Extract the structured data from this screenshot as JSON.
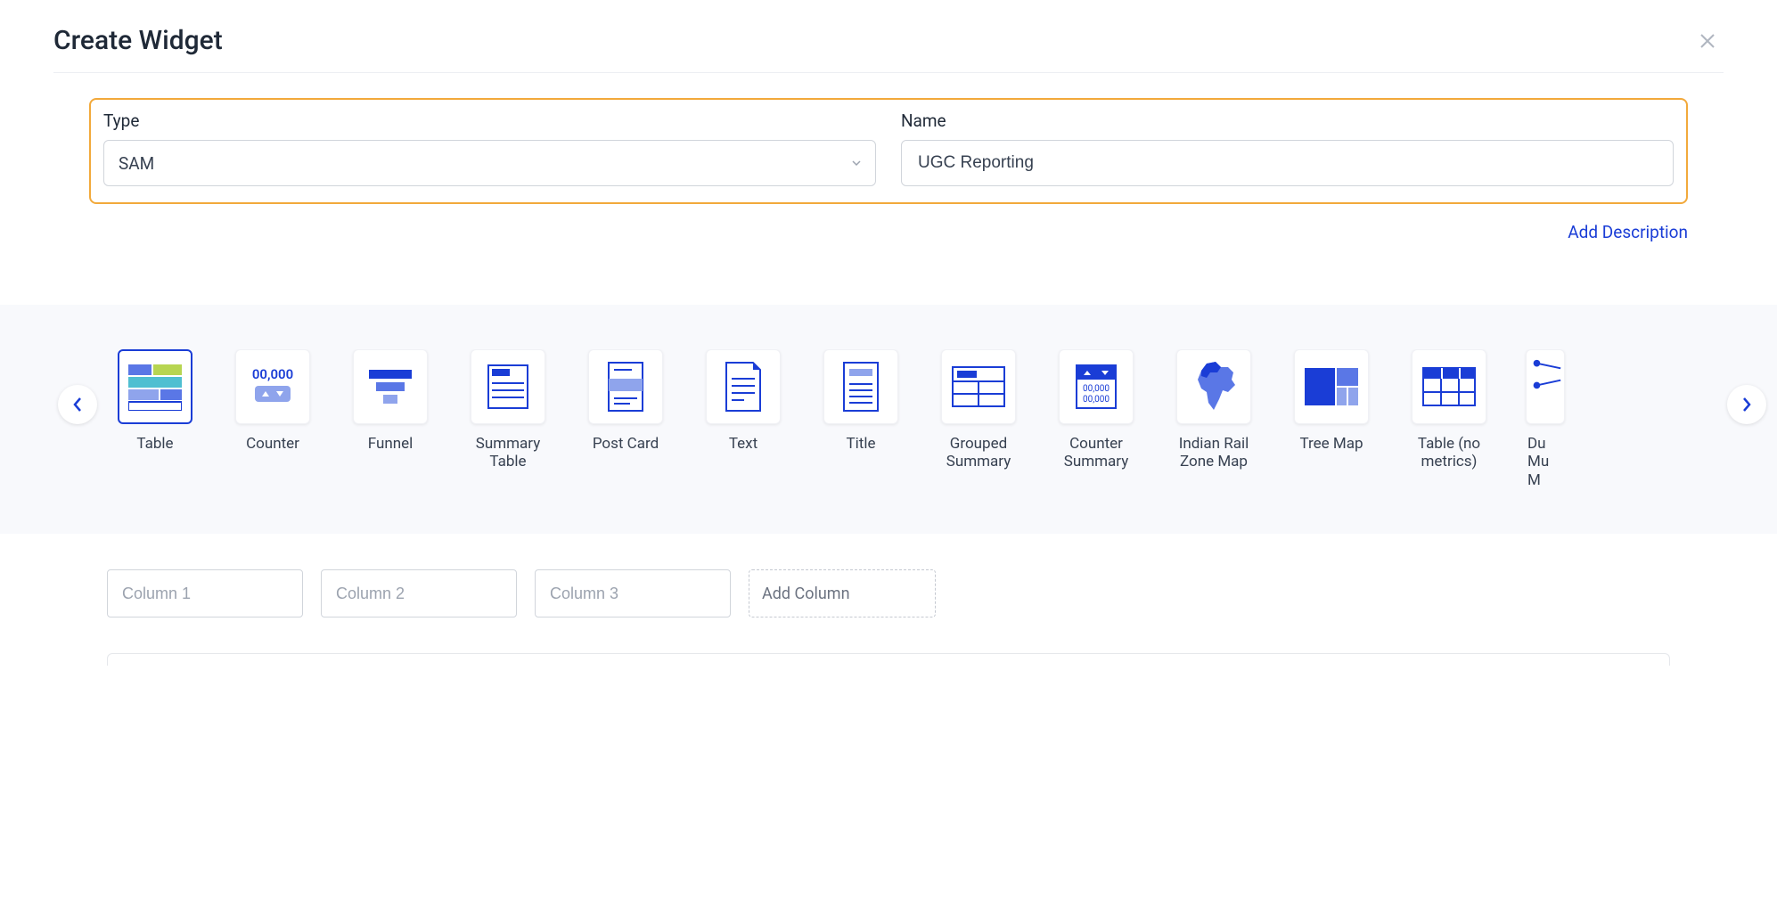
{
  "header": {
    "title": "Create Widget"
  },
  "form": {
    "type_label": "Type",
    "type_value": "SAM",
    "name_label": "Name",
    "name_value": "UGC Reporting",
    "add_description": "Add Description"
  },
  "widget_types": [
    {
      "id": "table",
      "label": "Table",
      "icon": "table-icon",
      "selected": true
    },
    {
      "id": "counter",
      "label": "Counter",
      "icon": "counter-icon",
      "selected": false
    },
    {
      "id": "funnel",
      "label": "Funnel",
      "icon": "funnel-icon",
      "selected": false
    },
    {
      "id": "summary-table",
      "label": "Summary Table",
      "icon": "summary-table-icon",
      "selected": false
    },
    {
      "id": "post-card",
      "label": "Post Card",
      "icon": "post-card-icon",
      "selected": false
    },
    {
      "id": "text",
      "label": "Text",
      "icon": "text-icon",
      "selected": false
    },
    {
      "id": "title",
      "label": "Title",
      "icon": "title-icon",
      "selected": false
    },
    {
      "id": "grouped-summary",
      "label": "Grouped Summary",
      "icon": "grouped-summary-icon",
      "selected": false
    },
    {
      "id": "counter-summary",
      "label": "Counter Summary",
      "icon": "counter-summary-icon",
      "selected": false
    },
    {
      "id": "indian-rail",
      "label": "Indian Rail Zone Map",
      "icon": "india-map-icon",
      "selected": false
    },
    {
      "id": "tree-map",
      "label": "Tree Map",
      "icon": "tree-map-icon",
      "selected": false
    },
    {
      "id": "table-no-metrics",
      "label": "Table (no metrics)",
      "icon": "table-outline-icon",
      "selected": false
    },
    {
      "id": "dual-multi",
      "label": "Du\nMu\nM",
      "icon": "dual-icon",
      "selected": false,
      "clipped": true
    }
  ],
  "columns": {
    "placeholder_1": "Column 1",
    "placeholder_2": "Column 2",
    "placeholder_3": "Column 3",
    "add_label": "Add Column"
  },
  "colors": {
    "brand": "#1a3dd6",
    "brand_mid": "#5a77e6",
    "brand_light": "#8fa4ec",
    "accent_green": "#b7d551",
    "accent_teal": "#4fbfd1"
  }
}
